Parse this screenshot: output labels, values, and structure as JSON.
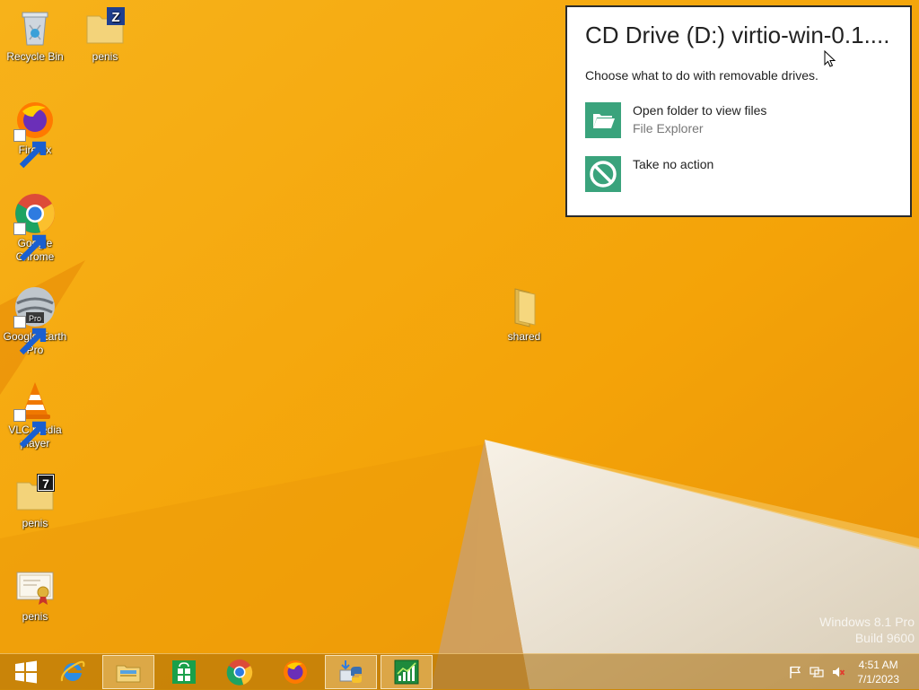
{
  "desktop": {
    "icons": [
      {
        "label": "Recycle Bin",
        "icon": "recycle-bin-icon"
      },
      {
        "label": "penis",
        "icon": "zip-folder-icon"
      },
      {
        "label": "Firefox",
        "icon": "firefox-icon"
      },
      {
        "label": "Google Chrome",
        "icon": "chrome-icon"
      },
      {
        "label": "Google Earth Pro",
        "icon": "google-earth-icon",
        "badge": "Pro"
      },
      {
        "label": "VLC media player",
        "icon": "vlc-icon"
      },
      {
        "label": "penis",
        "icon": "7zip-folder-icon",
        "badge": "7"
      },
      {
        "label": "penis",
        "icon": "certificate-icon"
      },
      {
        "label": "shared",
        "icon": "folder-icon"
      }
    ]
  },
  "autoplay": {
    "title": "CD Drive (D:) virtio-win-0.1....",
    "subtitle": "Choose what to do with removable drives.",
    "options": [
      {
        "label": "Open folder to view files",
        "sublabel": "File Explorer",
        "icon": "open-folder-icon"
      },
      {
        "label": "Take no action",
        "sublabel": "",
        "icon": "no-action-icon"
      }
    ]
  },
  "watermark": {
    "line1": "Windows 8.1 Pro",
    "line2": "Build 9600"
  },
  "taskbar": {
    "items": [
      {
        "name": "start-button",
        "icon": "windows-logo-icon"
      },
      {
        "name": "internet-explorer",
        "icon": "ie-icon"
      },
      {
        "name": "file-explorer",
        "icon": "file-explorer-icon",
        "active": true
      },
      {
        "name": "store",
        "icon": "store-icon"
      },
      {
        "name": "chrome",
        "icon": "chrome-icon"
      },
      {
        "name": "firefox",
        "icon": "firefox-icon"
      },
      {
        "name": "python-installer",
        "icon": "python-setup-icon",
        "active": true
      },
      {
        "name": "task-manager",
        "icon": "task-manager-icon",
        "active": true
      }
    ],
    "tray": {
      "time": "4:51 AM",
      "date": "7/1/2023"
    }
  },
  "colors": {
    "accent": "#3aa37c",
    "wallpaper": "#f6a90a",
    "badge_blue": "#1f3f8f"
  }
}
